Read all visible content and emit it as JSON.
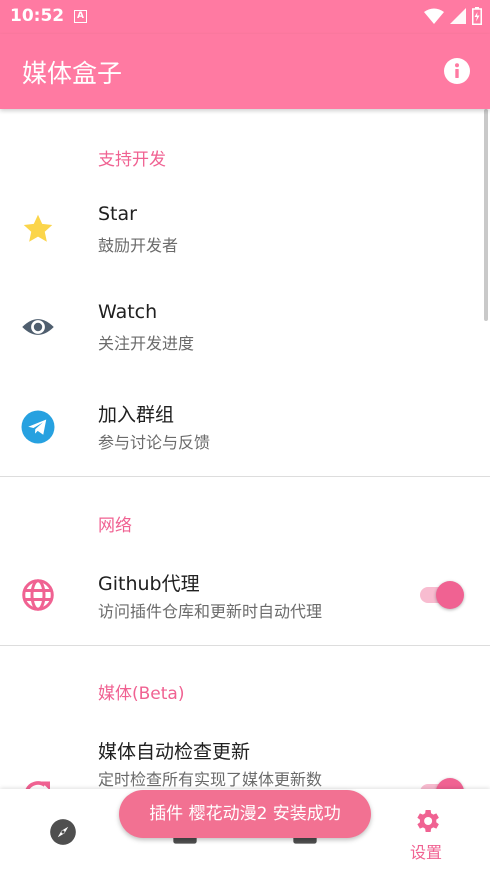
{
  "status_bar": {
    "time": "10:52",
    "notification_icon": "A"
  },
  "app_bar": {
    "title": "媒体盒子",
    "info_icon": "info-icon"
  },
  "sections": [
    {
      "header": "支持开发",
      "items": [
        {
          "title": "Star",
          "subtitle": "鼓励开发者",
          "icon": "star-icon",
          "icon_color": "#fbd54a"
        },
        {
          "title": "Watch",
          "subtitle": "关注开发进度",
          "icon": "eye-icon",
          "icon_color": "#4f5e6e"
        },
        {
          "title": "加入群组",
          "subtitle": "参与讨论与反馈",
          "icon": "telegram-icon",
          "icon_color": "#27a1e0"
        }
      ]
    },
    {
      "header": "网络",
      "items": [
        {
          "title": "Github代理",
          "subtitle": "访问插件仓库和更新时自动代理",
          "icon": "globe-icon",
          "icon_color": "#f06292",
          "toggle": true
        }
      ]
    },
    {
      "header": "媒体(Beta)",
      "items": [
        {
          "title": "媒体自动检查更新",
          "subtitle": "定时检查所有实现了媒体更新数",
          "icon": "update-icon",
          "icon_color": "#f06292",
          "toggle": true
        }
      ]
    }
  ],
  "bottom_nav": {
    "items": [
      {
        "icon": "compass-icon",
        "label": ""
      },
      {
        "icon": "calendar-icon",
        "label": ""
      },
      {
        "icon": "box-icon",
        "label": ""
      },
      {
        "icon": "gear-icon",
        "label": "设置",
        "selected": true
      }
    ]
  },
  "toast": {
    "text": "插件 樱花动漫2 安装成功"
  },
  "colors": {
    "primary": "#ff7aa2",
    "accent": "#f06292"
  }
}
